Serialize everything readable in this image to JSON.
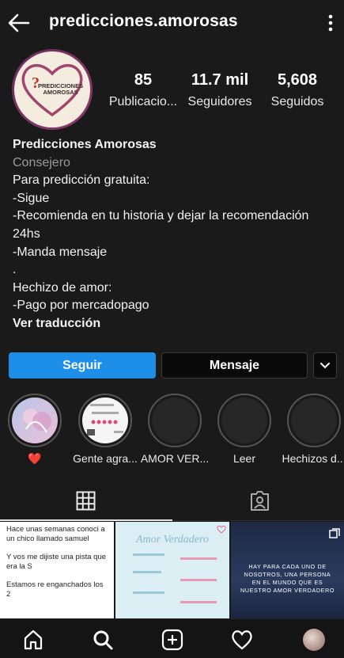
{
  "header": {
    "username": "predicciones.amorosas"
  },
  "profile": {
    "avatar_text_line1": "PREDICCIONES",
    "avatar_text_line2": "AMOROSAS",
    "stats": [
      {
        "value": "85",
        "label": "Publicacio..."
      },
      {
        "value": "11.7 mil",
        "label": "Seguidores"
      },
      {
        "value": "5,608",
        "label": "Seguidos"
      }
    ],
    "name": "Predicciones Amorosas",
    "category": "Consejero",
    "bio_lines": [
      "Para predicción gratuita:",
      " -Sigue",
      " -Recomienda en tu historia y dejar la recomendación 24hs",
      " -Manda mensaje",
      ".",
      "Hechizo de amor:",
      " -Pago por mercadopago"
    ],
    "translate_label": "Ver traducción"
  },
  "actions": {
    "follow_label": "Seguir",
    "message_label": "Mensaje"
  },
  "highlights": [
    {
      "label": "❤️"
    },
    {
      "label": "Gente agra..."
    },
    {
      "label": "AMOR VER..."
    },
    {
      "label": "Leer"
    },
    {
      "label": "Hechizos d..."
    }
  ],
  "posts": {
    "post1_lines": [
      "Hace unas semanas conoci a un chico llamado samuel",
      "Y vos me dijiste una pista que era la S",
      "Estamos re enganchados los 2"
    ],
    "post2_title": "Amor Verdadero",
    "post3_text": "HAY PARA CADA UNO DE NOSOTROS, UNA PERSONA EN EL MUNDO QUE ES NUESTRO AMOR VERDADERO"
  },
  "colors": {
    "accent": "#1e8fe8",
    "background": "#1a1a1a"
  }
}
